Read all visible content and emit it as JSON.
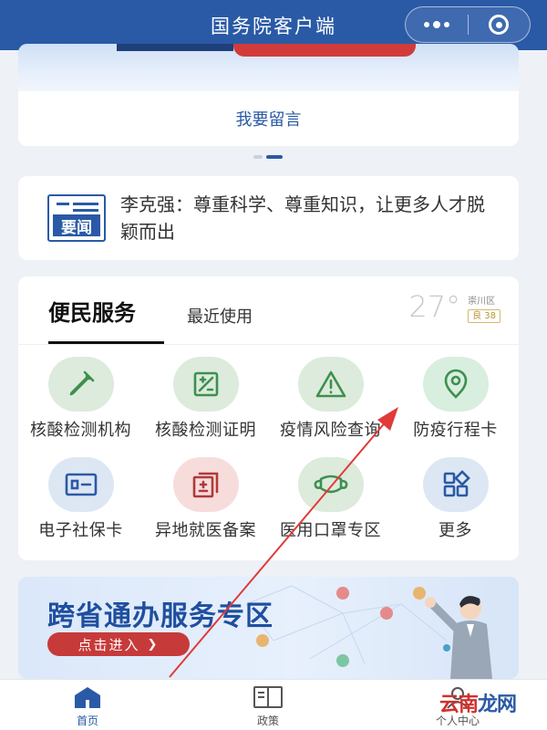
{
  "titlebar": {
    "title": "国务院客户端",
    "more_icon": "more-dots-icon",
    "close_icon": "target-circle-icon"
  },
  "banner": {
    "leave_message": "我要留言",
    "pager_count": 2,
    "pager_active": 1
  },
  "news": {
    "badge_label": "要闻",
    "text": "李克强：尊重科学、尊重知识，让更多人才脱颖而出"
  },
  "services": {
    "tab_main": "便民服务",
    "tab_recent": "最近使用",
    "weather": {
      "temperature": "27°",
      "district": "崇川区",
      "aqi": "良 38"
    },
    "items": [
      {
        "label": "核酸检测机构",
        "icon": "dropper-icon",
        "bg": "#dcebdc",
        "fg": "#3f8f4f"
      },
      {
        "label": "核酸检测证明",
        "icon": "certificate-icon",
        "bg": "#dcebdc",
        "fg": "#3f8f4f"
      },
      {
        "label": "疫情风险查询",
        "icon": "warning-icon",
        "bg": "#dcebdc",
        "fg": "#3f8f4f"
      },
      {
        "label": "防疫行程卡",
        "icon": "location-pin-icon",
        "bg": "#d8eedf",
        "fg": "#3f8f4f"
      },
      {
        "label": "电子社保卡",
        "icon": "id-card-icon",
        "bg": "#dde7f3",
        "fg": "#2a5aa6"
      },
      {
        "label": "异地就医备案",
        "icon": "medical-record-icon",
        "bg": "#f7dcdc",
        "fg": "#b03a3a"
      },
      {
        "label": "医用口罩专区",
        "icon": "mask-icon",
        "bg": "#dcebdc",
        "fg": "#3f8f4f"
      },
      {
        "label": "更多",
        "icon": "grid-more-icon",
        "bg": "#dde7f3",
        "fg": "#2a5aa6"
      }
    ]
  },
  "promo": {
    "title": "跨省通办服务专区",
    "button": "点击进入"
  },
  "tabbar": {
    "items": [
      {
        "label": "首页",
        "icon": "home-icon",
        "active": true
      },
      {
        "label": "政策",
        "icon": "book-icon",
        "active": false
      },
      {
        "label": "个人中心",
        "icon": "person-icon",
        "active": false
      }
    ]
  },
  "watermark": {
    "part1": "云南",
    "part2": "龙网"
  },
  "colors": {
    "primary": "#2a5aa6",
    "accent_red": "#d13b3b",
    "annotation_arrow": "#e03a3a"
  }
}
